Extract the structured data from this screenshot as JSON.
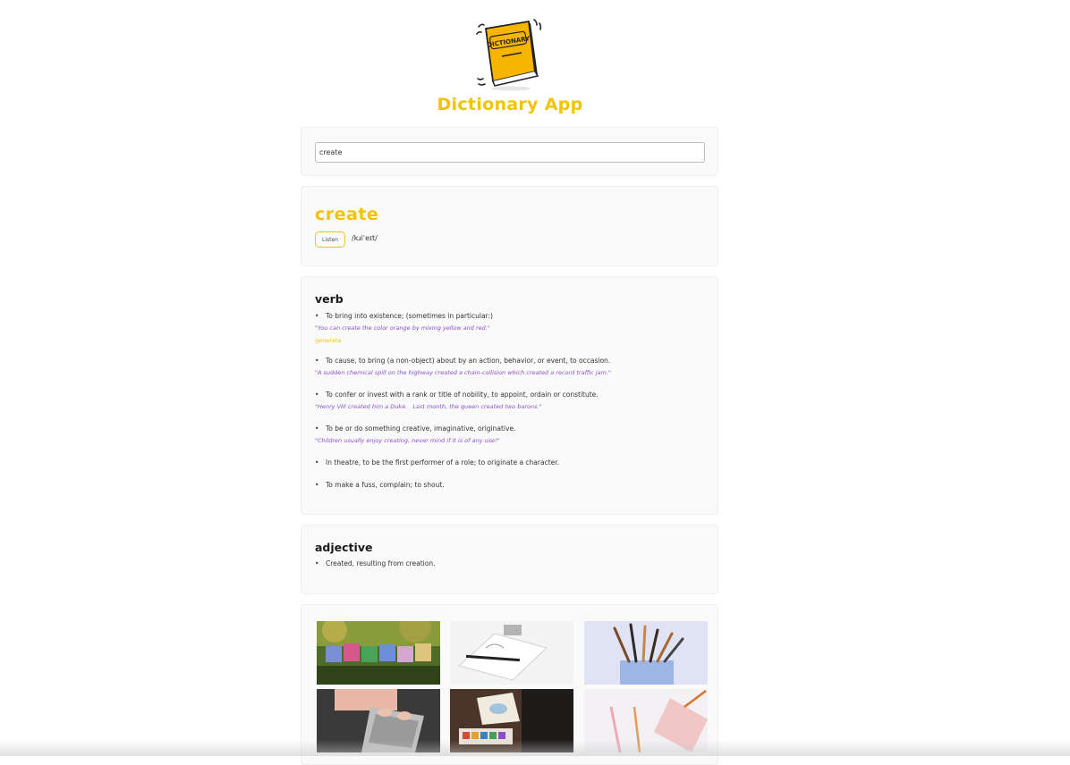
{
  "app": {
    "title": "Dictionary App",
    "logo_text": "DICTIONARY"
  },
  "search": {
    "value": "create",
    "placeholder": ""
  },
  "entry": {
    "word": "create",
    "listen_label": "Listen",
    "phonetic": "/kɹiˈeɪt/"
  },
  "meanings": [
    {
      "part_of_speech": "verb",
      "definitions": [
        {
          "text": "To bring into existence; (sometimes in particular:)",
          "example": "\"You can create the color orange by mixing yellow and red.\"",
          "synonym": "generate"
        },
        {
          "text": "To cause, to bring (a non-object) about by an action, behavior, or event, to occasion.",
          "example": "\"A sudden chemical spill on the highway created a chain-collision which created a record traffic jam.\""
        },
        {
          "text": "To confer or invest with a rank or title of nobility, to appoint, ordain or constitute.",
          "example": "\"Henry VIII created him a Duke.   Last month, the queen created two barons.\""
        },
        {
          "text": "To be or do something creative, imaginative, originative.",
          "example": "\"Children usually enjoy creating, never mind if it is of any use!\""
        },
        {
          "text": "In theatre, to be the first performer of a role; to originate a character."
        },
        {
          "text": "To make a fuss, complain; to shout."
        }
      ]
    },
    {
      "part_of_speech": "adjective",
      "definitions": [
        {
          "text": "Created, resulting from creation."
        }
      ]
    }
  ],
  "gallery": {
    "images": [
      {
        "subject": "letter-blocks-spelling-create-in-garden"
      },
      {
        "subject": "sketch-paper-and-pen-on-white-desk"
      },
      {
        "subject": "paint-brushes-in-jar"
      },
      {
        "subject": "hands-typing-on-laptop"
      },
      {
        "subject": "watercolor-painting-on-dark-table"
      },
      {
        "subject": "pencils-and-pink-paper-on-white"
      }
    ]
  },
  "colors": {
    "accent": "#f4c300",
    "example_text": "#8a4fc6",
    "book_cover": "#f7b500"
  }
}
